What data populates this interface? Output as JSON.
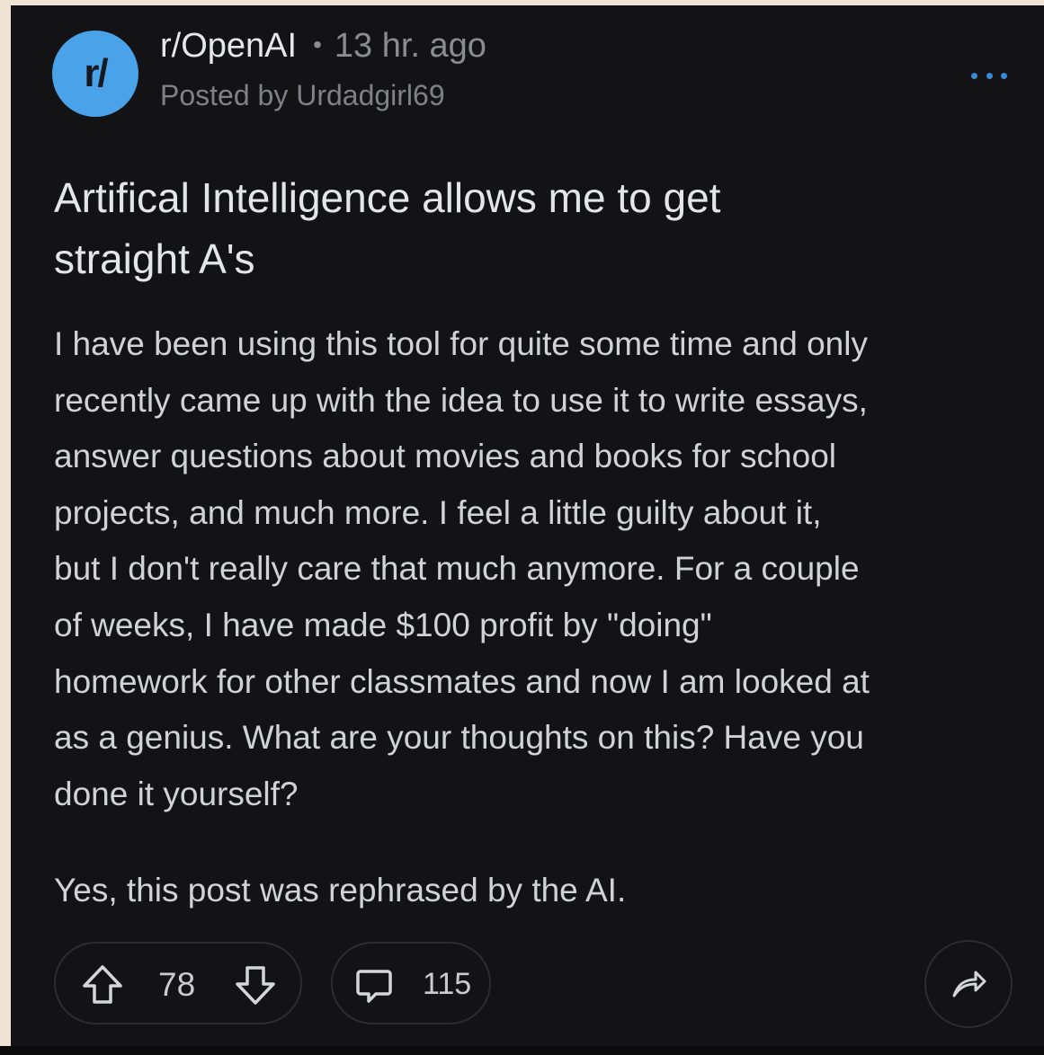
{
  "post": {
    "avatar_text": "r/",
    "subreddit": "r/OpenAI",
    "separator": "•",
    "time_ago": "13 hr. ago",
    "posted_by": "Posted by Urdadgirl69",
    "title_lines": [
      "Artifical Intelligence allows me to get",
      "straight A's"
    ],
    "body_lines": [
      "I have been using this tool for quite some time and only",
      "recently came up with the idea to use it to write essays,",
      "answer questions about movies and books for school",
      "projects, and much more. I feel a little guilty about it,",
      "but I don't really care that much anymore. For a couple",
      "of weeks, I have made $100 profit by \"doing\"",
      "homework for other classmates and now I am looked at",
      "as a genius. What are your thoughts on this? Have you",
      "done it yourself?"
    ],
    "footer_note": "Yes, this post was rephrased by the AI."
  },
  "actions": {
    "upvote_icon": "arrow-up-icon",
    "vote_count": "78",
    "downvote_icon": "arrow-down-icon",
    "comment_icon": "comment-icon",
    "comment_count": "115",
    "share_icon": "share-icon",
    "more_icon": "more-options-icon"
  },
  "colors": {
    "card_background": "#131315",
    "page_background": "#efe3d3",
    "avatar_blue": "#4aa3e8",
    "more_dots_blue": "#3b8ad9"
  }
}
